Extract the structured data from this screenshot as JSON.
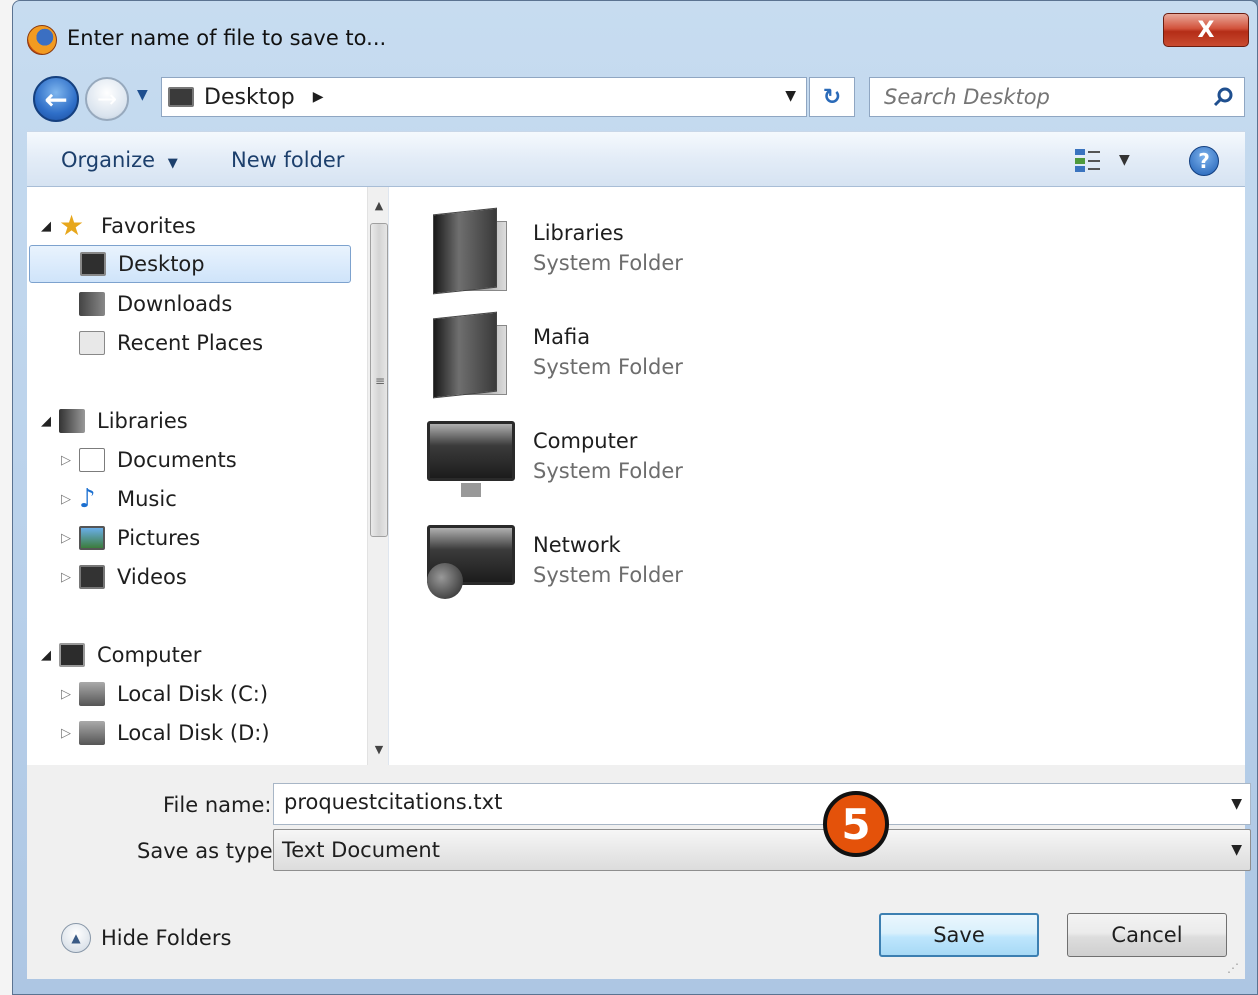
{
  "window": {
    "title": "Enter name of file to save to...",
    "close_label": "X"
  },
  "address_bar": {
    "location": "Desktop",
    "search_placeholder": "Search Desktop"
  },
  "toolbar": {
    "organize_label": "Organize",
    "new_folder_label": "New folder"
  },
  "nav_pane": {
    "favorites": {
      "label": "Favorites",
      "items": [
        {
          "label": "Desktop",
          "icon": "desktop-icon",
          "selected": true
        },
        {
          "label": "Downloads",
          "icon": "downloads-icon"
        },
        {
          "label": "Recent Places",
          "icon": "recent-places-icon"
        }
      ]
    },
    "libraries": {
      "label": "Libraries",
      "items": [
        {
          "label": "Documents",
          "icon": "documents-icon"
        },
        {
          "label": "Music",
          "icon": "music-icon"
        },
        {
          "label": "Pictures",
          "icon": "pictures-icon"
        },
        {
          "label": "Videos",
          "icon": "videos-icon"
        }
      ]
    },
    "computer": {
      "label": "Computer",
      "items": [
        {
          "label": "Local Disk (C:)",
          "icon": "disk-icon"
        },
        {
          "label": "Local Disk (D:)",
          "icon": "disk-icon"
        }
      ]
    }
  },
  "content": {
    "items": [
      {
        "name": "Libraries",
        "type": "System Folder",
        "icon": "libraries-folder-icon"
      },
      {
        "name": "Mafia",
        "type": "System Folder",
        "icon": "user-folder-icon"
      },
      {
        "name": "Computer",
        "type": "System Folder",
        "icon": "computer-icon"
      },
      {
        "name": "Network",
        "type": "System Folder",
        "icon": "network-icon"
      }
    ]
  },
  "save_form": {
    "file_name_label": "File name:",
    "file_name_value": "proquestcitations.txt",
    "save_as_type_label": "Save as type:",
    "save_as_type_value": "Text Document",
    "step_badge": "5",
    "hide_folders_label": "Hide Folders",
    "save_label": "Save",
    "cancel_label": "Cancel"
  },
  "colors": {
    "badge": "#e4520a",
    "selected_item": "#cfe4fa",
    "close_button": "#c94b30"
  }
}
